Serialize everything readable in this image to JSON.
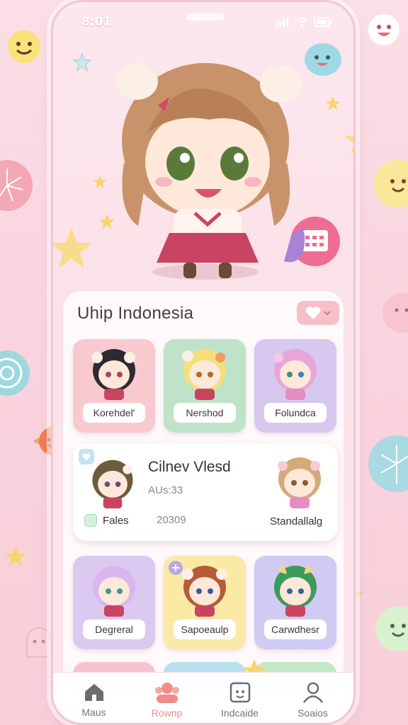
{
  "status_bar": {
    "time": "8:01"
  },
  "section": {
    "title": "Uhip Indonesia"
  },
  "tiles_row1": [
    {
      "label": "Korehdel'",
      "bg": "#f8c9cf"
    },
    {
      "label": "Nershod",
      "bg": "#bfe3c9"
    },
    {
      "label": "Folundca",
      "bg": "#d8c8ef"
    }
  ],
  "featured": {
    "name": "Cilnev Vlesd",
    "subtitle": "AUs:33",
    "tag": "Fales",
    "number": "20309",
    "right_label": "Standallalg"
  },
  "tiles_row3": [
    {
      "label": "Degreral",
      "bg": "#dcc9ef"
    },
    {
      "label": "Sapoeaulp",
      "bg": "#fbe9a6"
    },
    {
      "label": "Carwdhesr",
      "bg": "#cfcbf2"
    }
  ],
  "nav": [
    {
      "label": "Maus",
      "icon": "home-icon"
    },
    {
      "label": "Rownp",
      "icon": "community-icon"
    },
    {
      "label": "Indcaide",
      "icon": "calendar-icon"
    },
    {
      "label": "Soaios",
      "icon": "profile-icon"
    }
  ],
  "colors": {
    "accent": "#ec8d8a",
    "pink": "#f6c0cb",
    "text": "#3a3036"
  }
}
